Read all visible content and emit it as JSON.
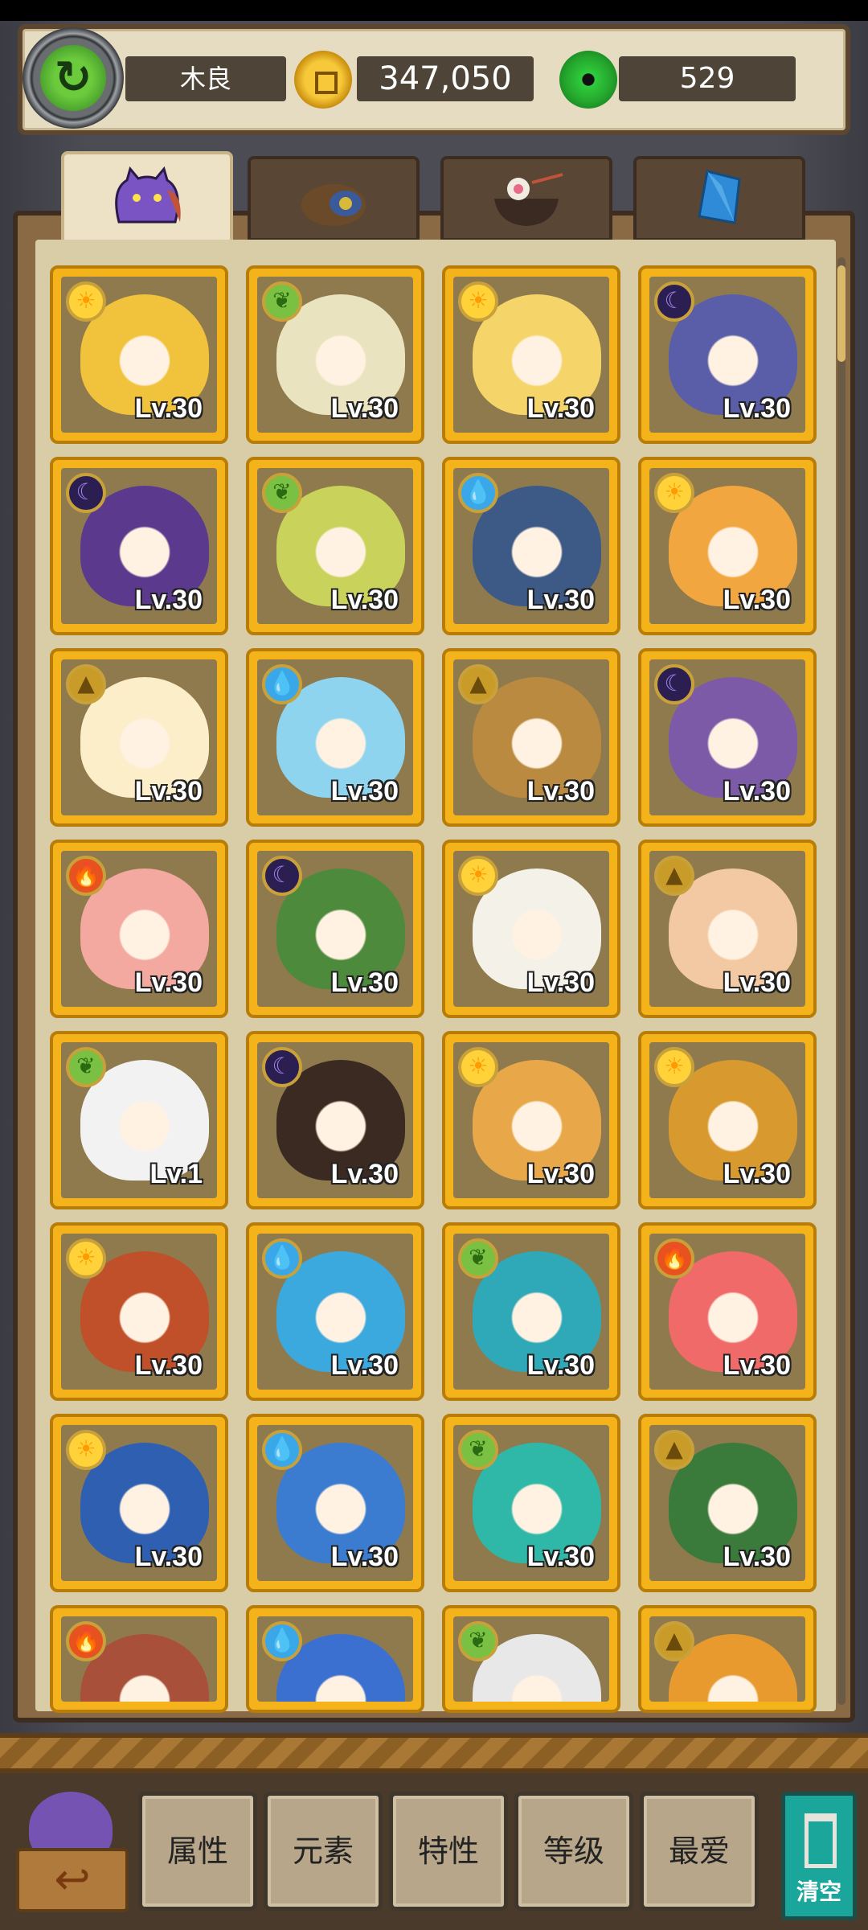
{
  "header": {
    "player_name": "木良",
    "gold": "347,050",
    "gems": "529"
  },
  "tabs": [
    {
      "name": "heroes",
      "icon": "purple-monster-icon",
      "active": true
    },
    {
      "name": "items",
      "icon": "treasure-icon",
      "active": false
    },
    {
      "name": "food",
      "icon": "food-bowl-icon",
      "active": false
    },
    {
      "name": "crystals",
      "icon": "crystal-icon",
      "active": false
    }
  ],
  "cards": [
    {
      "element": "sun",
      "level": "Lv.30",
      "color": "#f1c23b"
    },
    {
      "element": "leaf",
      "level": "Lv.30",
      "color": "#e9e4bf"
    },
    {
      "element": "sun",
      "level": "Lv.30",
      "color": "#f5d56a"
    },
    {
      "element": "moon",
      "level": "Lv.30",
      "color": "#5a5ea8"
    },
    {
      "element": "moon",
      "level": "Lv.30",
      "color": "#5b3a8e"
    },
    {
      "element": "leaf",
      "level": "Lv.30",
      "color": "#c9d25b"
    },
    {
      "element": "water",
      "level": "Lv.30",
      "color": "#3d5a86"
    },
    {
      "element": "sun",
      "level": "Lv.30",
      "color": "#f2a640"
    },
    {
      "element": "earth",
      "level": "Lv.30",
      "color": "#fbeec9"
    },
    {
      "element": "water",
      "level": "Lv.30",
      "color": "#8fd4ee"
    },
    {
      "element": "earth",
      "level": "Lv.30",
      "color": "#b98a3f"
    },
    {
      "element": "moon",
      "level": "Lv.30",
      "color": "#7c5aa8"
    },
    {
      "element": "fire",
      "level": "Lv.30",
      "color": "#f3a8a0"
    },
    {
      "element": "moon",
      "level": "Lv.30",
      "color": "#4e8a3c"
    },
    {
      "element": "sun",
      "level": "Lv.30",
      "color": "#f4f1e8"
    },
    {
      "element": "earth",
      "level": "Lv.30",
      "color": "#f2c9a2"
    },
    {
      "element": "leaf",
      "level": "Lv.1",
      "color": "#f2f2f2"
    },
    {
      "element": "moon",
      "level": "Lv.30",
      "color": "#3a2a22"
    },
    {
      "element": "sun",
      "level": "Lv.30",
      "color": "#e8a84a"
    },
    {
      "element": "sun",
      "level": "Lv.30",
      "color": "#d89a2e"
    },
    {
      "element": "sun",
      "level": "Lv.30",
      "color": "#c0502a"
    },
    {
      "element": "water",
      "level": "Lv.30",
      "color": "#3ba9de"
    },
    {
      "element": "leaf",
      "level": "Lv.30",
      "color": "#2fa8b8"
    },
    {
      "element": "fire",
      "level": "Lv.30",
      "color": "#f06a6a"
    },
    {
      "element": "sun",
      "level": "Lv.30",
      "color": "#2f5fb0"
    },
    {
      "element": "water",
      "level": "Lv.30",
      "color": "#3b7bd0"
    },
    {
      "element": "leaf",
      "level": "Lv.30",
      "color": "#2fb8a8"
    },
    {
      "element": "earth",
      "level": "Lv.30",
      "color": "#3a7a3a"
    },
    {
      "element": "fire",
      "level": "",
      "color": "#a8503a"
    },
    {
      "element": "water",
      "level": "",
      "color": "#3b6fd0"
    },
    {
      "element": "leaf",
      "level": "",
      "color": "#e8e8e8"
    },
    {
      "element": "earth",
      "level": "",
      "color": "#e89a2e"
    }
  ],
  "filters": {
    "attribute": "属性",
    "element": "元素",
    "trait": "特性",
    "level": "等级",
    "favorite": "最爱"
  },
  "clear_label": "清空",
  "back_icon": "↩"
}
